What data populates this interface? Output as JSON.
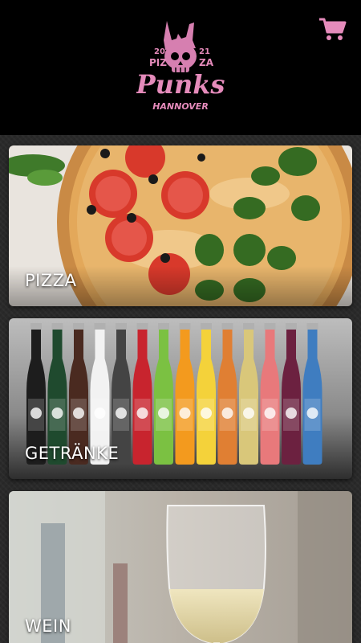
{
  "header": {
    "logo": {
      "year_left": "20",
      "year_right": "21",
      "piz": "PIZ",
      "za": "ZA",
      "brand": "Punks",
      "city": "HANNOVER"
    },
    "cart_icon": "shopping-cart-icon"
  },
  "colors": {
    "accent_pink": "#e58bbb",
    "header_bg": "#000000",
    "page_bg": "#2a2a2a"
  },
  "categories": [
    {
      "label": "PIZZA"
    },
    {
      "label": "GETRÄNKE"
    },
    {
      "label": "WEIN"
    }
  ]
}
